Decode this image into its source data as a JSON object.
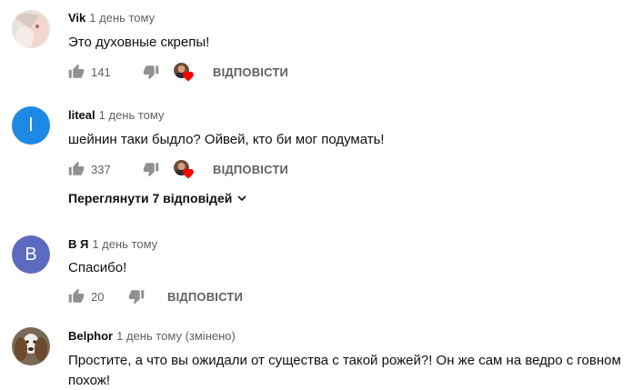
{
  "comments": [
    {
      "author": "Vik",
      "time": "1 день тому",
      "text": "Это духовные скрепы!",
      "likes": "141",
      "reply_label": "ВІДПОВІСТИ",
      "avatar_icon": "photo-avatar"
    },
    {
      "author": "liteal",
      "time": "1 день тому",
      "text": "шейнин таки быдло? Ойвей, кто би мог подумать!",
      "likes": "337",
      "reply_label": "ВІДПОВІСТИ",
      "avatar_letter": "l",
      "avatar_color": "#1e88e5",
      "view_replies": "Переглянути 7 відповідей"
    },
    {
      "author": "В Я",
      "time": "1 день тому",
      "text": "Спасибо!",
      "likes": "20",
      "reply_label": "ВІДПОВІСТИ",
      "avatar_letter": "B",
      "avatar_color": "#5c6bc0"
    },
    {
      "author": "Belphor",
      "time": "1 день тому (змінено)",
      "text_line1": "Простите, а что вы ожидали от существа с такой рожей?! Он же сам на ведро с говном",
      "text_line2": "похож!",
      "avatar_icon": "dog-photo-avatar"
    }
  ],
  "colors": {
    "heart": "#ff0000",
    "secondary": "#606060"
  }
}
